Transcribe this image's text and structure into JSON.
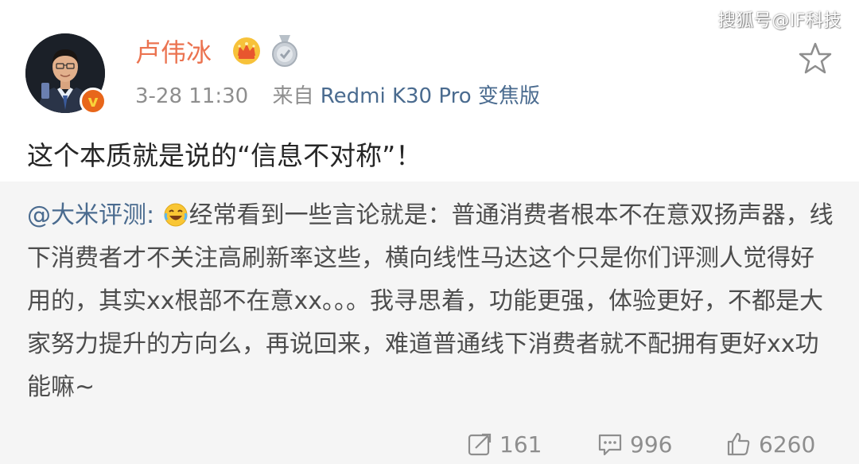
{
  "watermark": "搜狐号@IF科技",
  "post": {
    "author": "卢伟冰",
    "verified_mark": "v",
    "time": "3-28 11:30",
    "source_prefix": "来自",
    "source_device": "Redmi K30 Pro 变焦版",
    "text": "这个本质就是说的“信息不对称”！"
  },
  "repost": {
    "mention": "@大米评测:",
    "text": "经常看到一些言论就是：普通消费者根本不在意双扬声器，线下消费者才不关注高刷新率这些，横向线性马达这个只是你们评测人觉得好用的，其实xx根部不在意xx。。。我寻思着，功能更强，体验更好，不都是大家努力提升的方向么，再说回来，难道普通线下消费者就不配拥有更好xx功能嘛~",
    "emoji": "laughing-tears-icon"
  },
  "actions": {
    "reposts": "161",
    "comments": "996",
    "likes": "6260"
  },
  "colors": {
    "author": "#eb7350",
    "link": "#4a6b8f",
    "meta": "#8e8e8e",
    "repost_bg": "#f5f5f5"
  },
  "icons": [
    "crown-icon",
    "medal-icon",
    "star-icon",
    "repost-icon",
    "comment-icon",
    "like-icon",
    "laughing-tears-icon"
  ]
}
